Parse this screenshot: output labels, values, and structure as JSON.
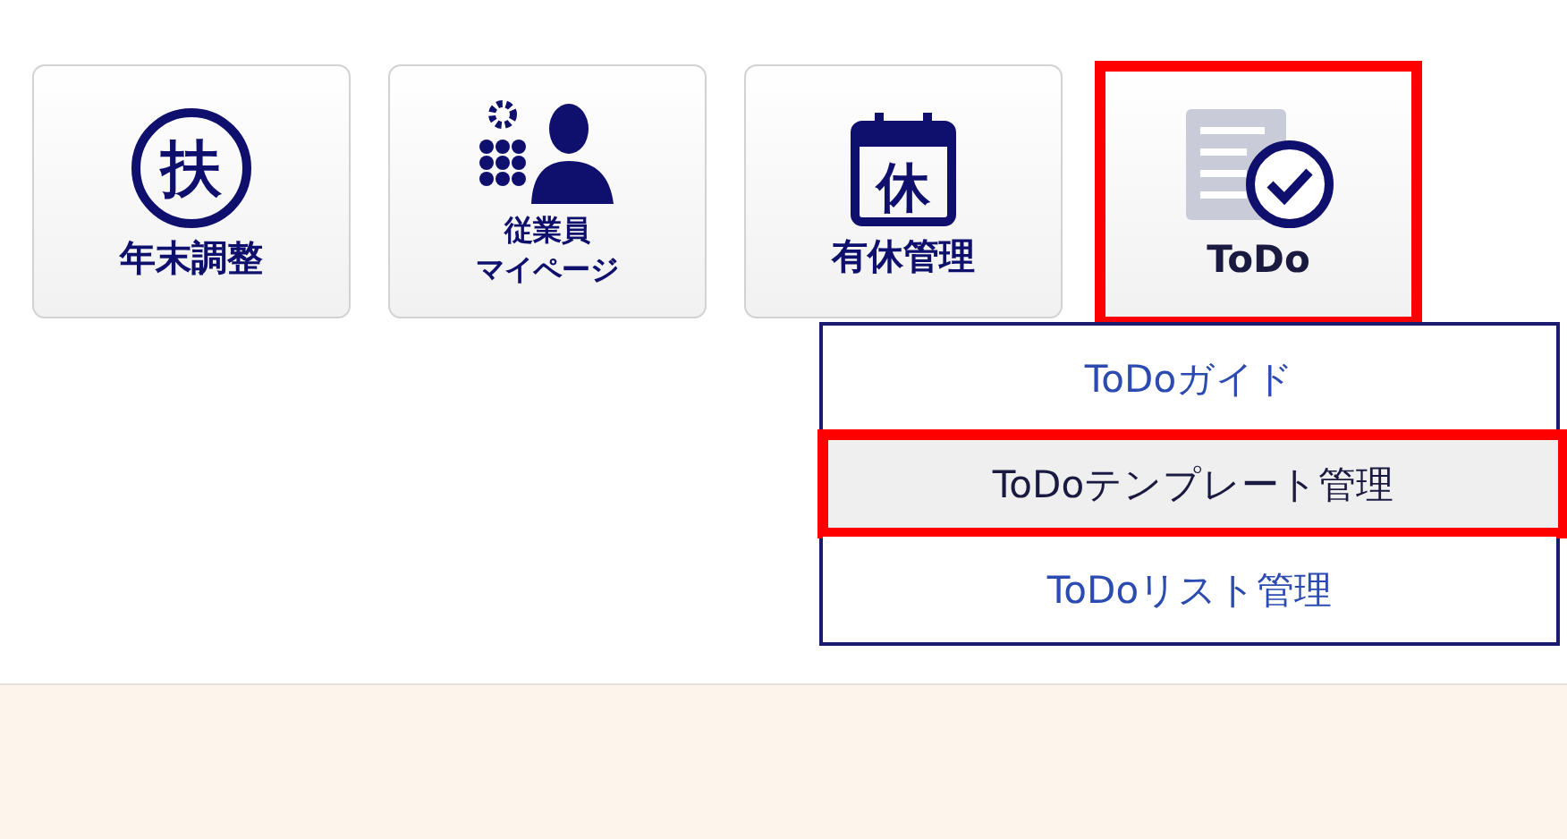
{
  "toolbar": [
    {
      "kind": "seal",
      "icon_text": "扶",
      "label_lines": [
        "年末調整"
      ],
      "highlighted": false
    },
    {
      "kind": "staff",
      "label_lines": [
        "従業員",
        "マイページ"
      ],
      "highlighted": false
    },
    {
      "kind": "calendar",
      "icon_text": "休",
      "label_lines": [
        "有休管理"
      ],
      "highlighted": false
    },
    {
      "kind": "todo",
      "label_lines": [
        "ToDo"
      ],
      "highlighted": true
    }
  ],
  "dropdown": {
    "items": [
      {
        "label": "ToDoガイド",
        "selected": false,
        "highlighted": false
      },
      {
        "label": "ToDoテンプレート管理",
        "selected": true,
        "highlighted": true
      },
      {
        "label": "ToDoリスト管理",
        "selected": false,
        "highlighted": false
      }
    ]
  }
}
